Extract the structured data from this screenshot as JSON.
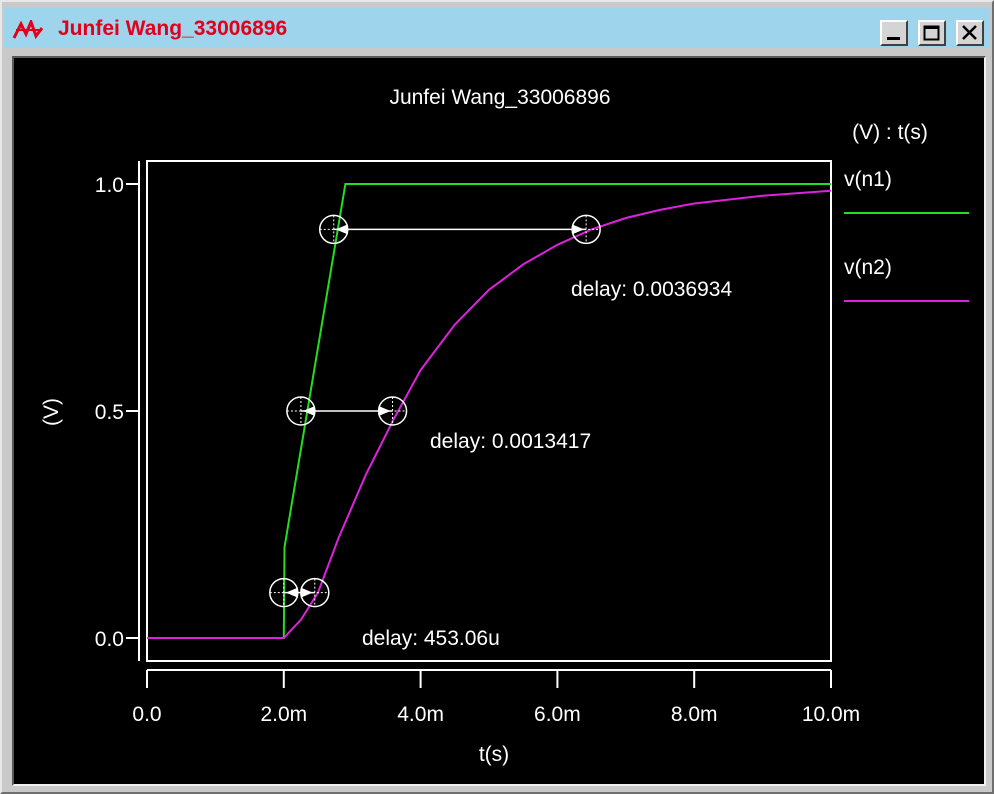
{
  "window": {
    "title": "Junfei Wang_33006896",
    "app_icon": "waveform-app-icon",
    "buttons": {
      "minimize": "minimize-icon",
      "maximize": "maximize-icon",
      "close": "close-icon"
    }
  },
  "colors": {
    "titlebar": "#9ed4ec",
    "title_text": "#e2001a",
    "plot_background": "#000000",
    "axes": "#ffffff",
    "n1": "#22dd22",
    "n2": "#dd22dd",
    "marker": "#ffffff"
  },
  "chart_data": {
    "type": "line",
    "title": "Junfei Wang_33006896",
    "xlabel": "t(s)",
    "ylabel": "(V)",
    "legend_title": "(V) : t(s)",
    "legend_position": "right",
    "grid": false,
    "xlim": [
      0,
      0.01
    ],
    "ylim": [
      0,
      1
    ],
    "x_ticks": [
      {
        "value": 0,
        "label": "0.0"
      },
      {
        "value": 0.002,
        "label": "2.0m"
      },
      {
        "value": 0.004,
        "label": "4.0m"
      },
      {
        "value": 0.006,
        "label": "6.0m"
      },
      {
        "value": 0.008,
        "label": "8.0m"
      },
      {
        "value": 0.01,
        "label": "10.0m"
      }
    ],
    "y_ticks": [
      {
        "value": 0,
        "label": "0.0"
      },
      {
        "value": 0.5,
        "label": "0.5"
      },
      {
        "value": 1,
        "label": "1.0"
      }
    ],
    "series": [
      {
        "name": "v(n1)",
        "color": "#22dd22",
        "x": [
          0,
          0.002,
          0.00201,
          0.0029,
          0.01
        ],
        "y": [
          0,
          0,
          0.2,
          1,
          1
        ]
      },
      {
        "name": "v(n2)",
        "color": "#dd22dd",
        "x": [
          0,
          0.002,
          0.00225,
          0.0025,
          0.0028,
          0.0032,
          0.0036,
          0.004,
          0.0045,
          0.005,
          0.0055,
          0.006,
          0.0065,
          0.007,
          0.0075,
          0.008,
          0.009,
          0.01
        ],
        "y": [
          0,
          0,
          0.04,
          0.1,
          0.22,
          0.36,
          0.48,
          0.59,
          0.69,
          0.767,
          0.823,
          0.866,
          0.9,
          0.925,
          0.943,
          0.957,
          0.974,
          0.985
        ]
      }
    ],
    "delays": [
      {
        "level": 0.1,
        "x_start": 0.002,
        "x_end": 0.00245306,
        "label": "delay: 453.06u"
      },
      {
        "level": 0.5,
        "x_start": 0.00225,
        "x_end": 0.00359,
        "label": "delay: 0.0013417"
      },
      {
        "level": 0.9,
        "x_start": 0.00273,
        "x_end": 0.00642,
        "label": "delay: 0.0036934"
      }
    ]
  }
}
